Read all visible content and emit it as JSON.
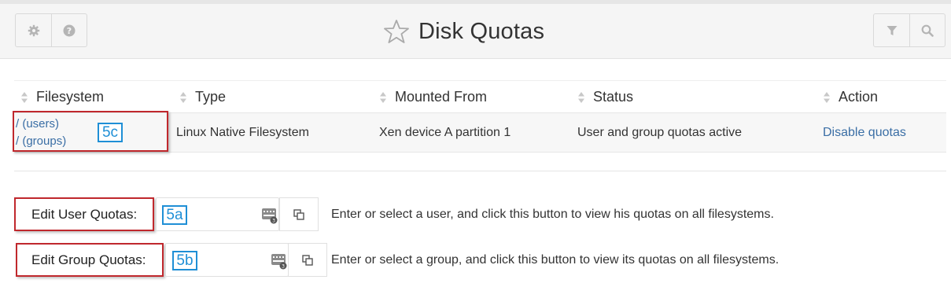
{
  "header": {
    "title": "Disk Quotas",
    "left_buttons": [
      "gear-icon",
      "help-icon"
    ],
    "right_buttons": [
      "filter-icon",
      "search-icon"
    ]
  },
  "table": {
    "columns": [
      "Filesystem",
      "Type",
      "Mounted From",
      "Status",
      "Action"
    ],
    "rows": [
      {
        "filesystem_users": "/ (users)",
        "filesystem_groups": "/ (groups)",
        "type": "Linux Native Filesystem",
        "mounted_from": "Xen device A partition 1",
        "status": "User and group quotas active",
        "action": "Disable quotas"
      }
    ]
  },
  "annotations": {
    "a5c": "5c",
    "a5a": "5a",
    "a5b": "5b",
    "color_red": "#c0282d",
    "color_blue": "#1f8fd6"
  },
  "user_quota": {
    "button_label": "Edit User Quotas:",
    "input_value": "",
    "description": "Enter or select a user, and click this button to view his quotas on all filesystems."
  },
  "group_quota": {
    "button_label": "Edit Group Quotas:",
    "input_value": "",
    "description": "Enter or select a group, and click this button to view its quotas on all filesystems."
  },
  "colors": {
    "link": "#3a6ea5",
    "row_bg": "#f7f7f7",
    "header_bg": "#f5f5f5"
  }
}
